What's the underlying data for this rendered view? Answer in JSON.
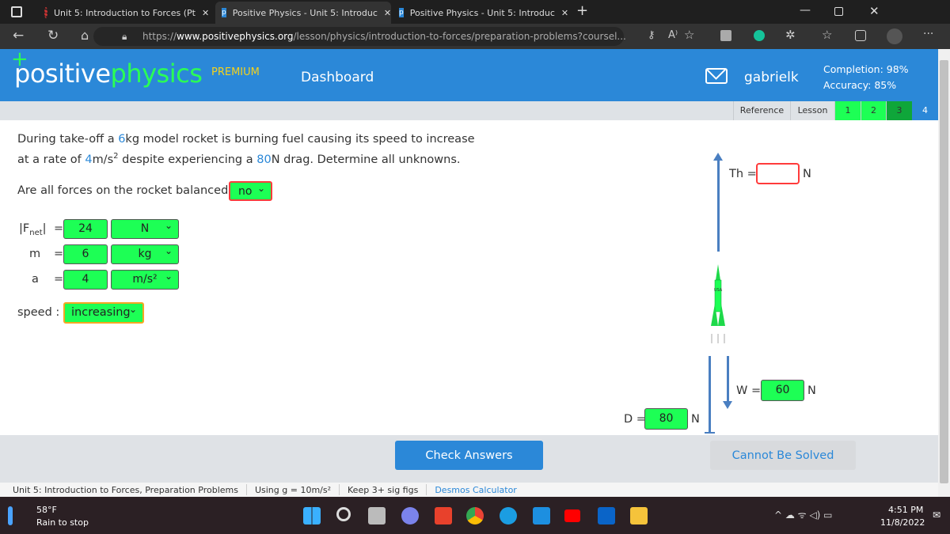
{
  "browser": {
    "tabs": [
      {
        "title": "Unit 5: Introduction to Forces (Pt",
        "active": false
      },
      {
        "title": "Positive Physics - Unit 5: Introduc",
        "active": true
      },
      {
        "title": "Positive Physics - Unit 5: Introduc",
        "active": false
      }
    ],
    "url_prefix": "https://",
    "url_domain": "www.positivephysics.org",
    "url_path": "/lesson/physics/introduction-to-forces/preparation-problems?coursel..."
  },
  "header": {
    "logo_part1": "positive",
    "logo_part2": "physics",
    "premium": "PREMIUM",
    "dashboard": "Dashboard",
    "username": "gabrielk",
    "completion": "Completion: 98%",
    "accuracy": "Accuracy: 85%"
  },
  "subnav": {
    "reference": "Reference",
    "lesson": "Lesson",
    "pages": [
      "1",
      "2",
      "3",
      "4"
    ]
  },
  "problem": {
    "line1_a": "During take-off a ",
    "mass": "6",
    "line1_b": "kg model rocket is burning fuel causing its speed to increase",
    "line2_a": "at a rate of ",
    "accel": "4",
    "line2_b": "m/s",
    "line2_sup": "2",
    "line2_c": " despite experiencing a ",
    "drag": "80",
    "line2_d": "N drag. Determine all unknowns."
  },
  "form": {
    "balanced_q": "Are all forces on the rocket balanced?",
    "balanced_val": "no",
    "rows": [
      {
        "label": "|Fnet|",
        "eq": "=",
        "value": "24",
        "unit": "N"
      },
      {
        "label": "m",
        "eq": "=",
        "value": "6",
        "unit": "kg"
      },
      {
        "label": "a",
        "eq": "=",
        "value": "4",
        "unit": "m/s²"
      }
    ],
    "speed_label": "speed :",
    "speed_val": "increasing"
  },
  "diagram": {
    "th_label": "Th =",
    "th_value": "",
    "th_unit": "N",
    "w_label": "W =",
    "w_value": "60",
    "w_unit": "N",
    "d_label": "D =",
    "d_value": "80",
    "d_unit": "N",
    "rocket_text": "USA"
  },
  "buttons": {
    "check": "Check Answers",
    "cannot": "Cannot Be Solved"
  },
  "info": {
    "unit": "Unit 5: Introduction to Forces, Preparation Problems",
    "g": "Using g = 10m/s²",
    "sigfigs": "Keep 3+ sig figs",
    "desmos": "Desmos Calculator"
  },
  "taskbar": {
    "temp": "58°F",
    "weather": "Rain to stop",
    "time": "4:51 PM",
    "date": "11/8/2022"
  },
  "colors": {
    "brand": "#2b88d8",
    "correct": "#1dff55",
    "wrong": "#ff3b3b",
    "warn": "#f5a623"
  }
}
